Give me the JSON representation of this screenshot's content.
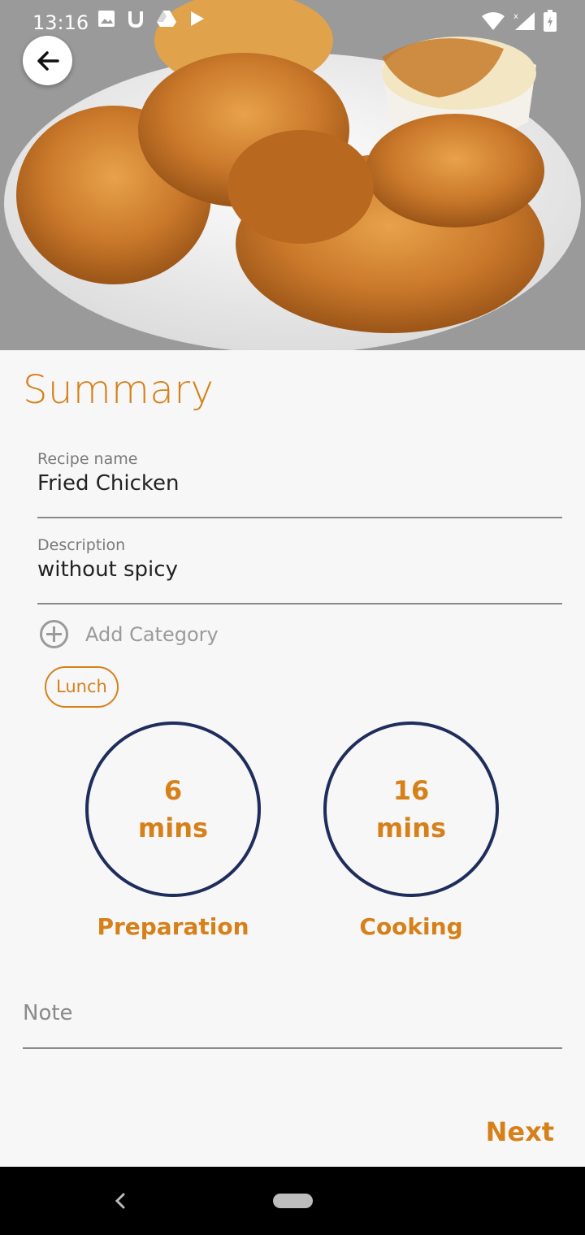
{
  "status_bar": {
    "time": "13:16",
    "left_icons": [
      "image-icon",
      "u-icon",
      "drive-icon",
      "play-icon"
    ],
    "right_icons": [
      "wifi-icon",
      "signal-icon",
      "battery-icon"
    ]
  },
  "hero": {
    "image": "fried-chicken-plate",
    "back_icon": "arrow-left-icon"
  },
  "page": {
    "title": "Summary"
  },
  "form": {
    "recipe_name_label": "Recipe name",
    "recipe_name_value": "Fried Chicken",
    "description_label": "Description",
    "description_value": "without spicy",
    "add_category_label": "Add Category",
    "categories": [
      "Lunch"
    ]
  },
  "timers": {
    "preparation": {
      "value": "6",
      "unit": "mins",
      "label": "Preparation"
    },
    "cooking": {
      "value": "16",
      "unit": "mins",
      "label": "Cooking"
    }
  },
  "note": {
    "placeholder": "Note"
  },
  "actions": {
    "next_label": "Next"
  },
  "colors": {
    "accent": "#d6801a",
    "circle": "#1f2d5c",
    "background": "#f7f7f7"
  }
}
